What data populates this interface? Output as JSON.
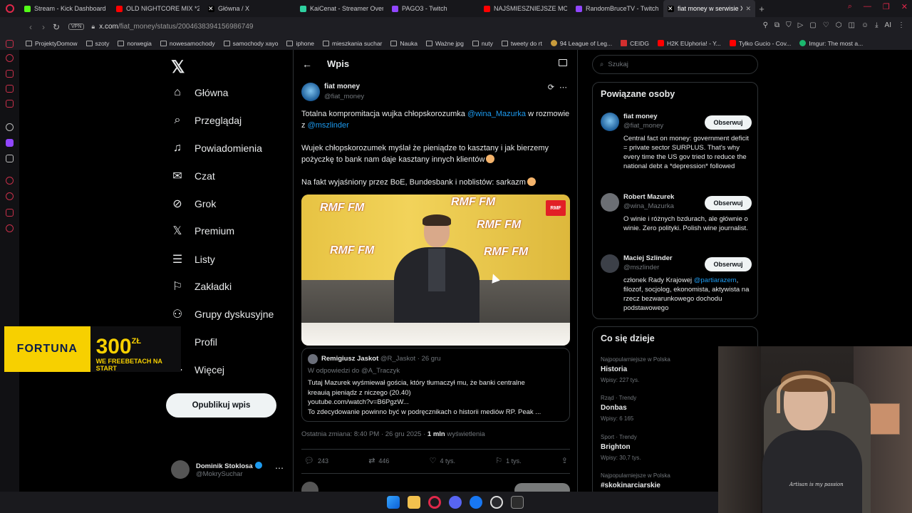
{
  "browser": {
    "tabs": [
      {
        "label": "Stream - Kick Dashboard",
        "color": "#53fc18"
      },
      {
        "label": "OLD NIGHTCORE MIX *20",
        "color": "#ff0000"
      },
      {
        "label": "Główna / X",
        "color": "#ffffff"
      },
      {
        "label": "KaiCenat - Streamer Over",
        "color": "#2fd1a0"
      },
      {
        "label": "PAGO3 - Twitch",
        "color": "#9146ff"
      },
      {
        "label": "NAJŚMIESZNIEJSZE MOM",
        "color": "#ff0000"
      },
      {
        "label": "RandomBruceTV - Twitch",
        "color": "#9146ff"
      },
      {
        "label": "fiat money w serwisie X: ,",
        "color": "#ffffff"
      }
    ],
    "new_tab": "+",
    "vpn_label": "VPN",
    "url_host": "x.com",
    "url_path": "/fiat_money/status/2004638394156986749",
    "bookmarks": [
      "ProjektyDomow",
      "szoty",
      "norwegia",
      "nowesamochody",
      "samochody xayo",
      "iphone",
      "mieszkania suchar",
      "Nauka",
      "Ważne jpg",
      "nuty",
      "tweety do rt",
      "94 League of Leg...",
      "CEIDG",
      "H2K EUphoria! - Y...",
      "Tylko Gucio - Cov...",
      "Imgur: The most a..."
    ],
    "ai_label": "AI"
  },
  "nav": {
    "items": [
      {
        "label": "Główna",
        "icon": "home-icon",
        "glyph": "⌂"
      },
      {
        "label": "Przeglądaj",
        "icon": "search-icon",
        "glyph": "⌕"
      },
      {
        "label": "Powiadomienia",
        "icon": "bell-icon",
        "glyph": "🔔"
      },
      {
        "label": "Czat",
        "icon": "mail-icon",
        "glyph": "✉"
      },
      {
        "label": "Grok",
        "icon": "grok-icon",
        "glyph": "⊘"
      },
      {
        "label": "Premium",
        "icon": "x-premium-icon",
        "glyph": "𝕏"
      },
      {
        "label": "Listy",
        "icon": "list-icon",
        "glyph": "☰"
      },
      {
        "label": "Zakładki",
        "icon": "bookmark-icon",
        "glyph": "⚐"
      },
      {
        "label": "Grupy dyskusyjne",
        "icon": "communities-icon",
        "glyph": "⚇"
      },
      {
        "label": "Profil",
        "icon": "profile-icon",
        "glyph": "☺"
      },
      {
        "label": "Więcej",
        "icon": "more-icon",
        "glyph": "⋯"
      }
    ],
    "post_button": "Opublikuj wpis",
    "account_name": "Dominik Stoklosa",
    "account_handle": "@MokrySuchar"
  },
  "ad": {
    "brand": "FORTUNA",
    "amount": "300",
    "currency": "ZŁ",
    "line1": "WE FREEBETACH NA START"
  },
  "post": {
    "header_title": "Wpis",
    "author_name": "fiat money",
    "author_handle": "@fiat_money",
    "p1_a": "Totalna kompromitacja wujka chłopskorozumka ",
    "p1_m1": "@wina_Mazurka",
    "p1_b": " w rozmowie z ",
    "p1_m2": "@mszlinder",
    "p2": "Wujek chłopskorozumek myślał że pieniądze to kasztany i jak bierzemy pożyczkę to bank nam daje kasztany innych klientów",
    "p3": "Na fakt wyjaśniony przez BoE, Bundesbank i noblistów: sarkazm",
    "media_labels": [
      "RMF FM",
      "RMF FM",
      "RMF FM",
      "RMF FM",
      "RMF FM"
    ],
    "quote": {
      "name": "Remigiusz Jaskot",
      "handle": "@R_Jaskot",
      "date": "· 26 gru",
      "reply_to": "W odpowiedzi do @A_Traczyk",
      "lines": [
        "Tutaj Mazurek wyśmiewał gościa, który tłumaczył mu, że banki centralne",
        "kreauią pieniądz z niczego (20.40)",
        "youtube.com/watch?v=B6PgzW...",
        "To zdecydowanie powinno być w podręcznikach o historii mediów RP. Peak ..."
      ]
    },
    "meta_time": "Ostatnia zmiana: 8:40 PM · 26 gru 2025 · ",
    "meta_views": "1 mln",
    "meta_views_label": " wyświetlenia",
    "replies": "243",
    "reposts": "446",
    "likes": "4 tys.",
    "bookmarks": "1 tys."
  },
  "sidebar": {
    "search_placeholder": "Szukaj",
    "related_title": "Powiązane osoby",
    "people": [
      {
        "name": "fiat money",
        "handle": "@fiat_money",
        "bio": "Central fact on money: government deficit = private sector SURPLUS. That's why every time the US gov tried to reduce the national debt a *depression* followed",
        "follow": "Obserwuj"
      },
      {
        "name": "Robert Mazurek",
        "handle": "@wina_Mazurka",
        "bio": "O winie i różnych bzdurach, ale głównie o winie. Zero polityki. Polish wine journalist.",
        "follow": "Obserwuj"
      },
      {
        "name": "Maciej Szlinder",
        "handle": "@mszlinder",
        "bio_a": "członek Rady Krajowej ",
        "bio_m": "@partiarazem",
        "bio_b": ", filozof, socjolog, ekonomista, aktywista na rzecz bezwarunkowego dochodu podstawowego",
        "follow": "Obserwuj"
      }
    ],
    "trends_title": "Co się dzieje",
    "trends": [
      {
        "context": "Najpopularniejsze w Polska",
        "name": "Historia",
        "posts": "Wpisy: 227 tys."
      },
      {
        "context": "Rząd · Trendy",
        "name": "Donbas",
        "posts": "Wpisy: 6 165"
      },
      {
        "context": "Sport · Trendy",
        "name": "Brighton",
        "posts": "Wpisy: 30,7 tys."
      },
      {
        "context": "Najpopularniejsze w Polska",
        "name": "#skokinarciarskie",
        "posts": ""
      }
    ]
  },
  "webcam": {
    "shirt_text": "Artisan is my passion"
  },
  "colors": {
    "accent": "#1d9bf0",
    "opera": "#e0284a",
    "fortuna": "#f7d000"
  }
}
